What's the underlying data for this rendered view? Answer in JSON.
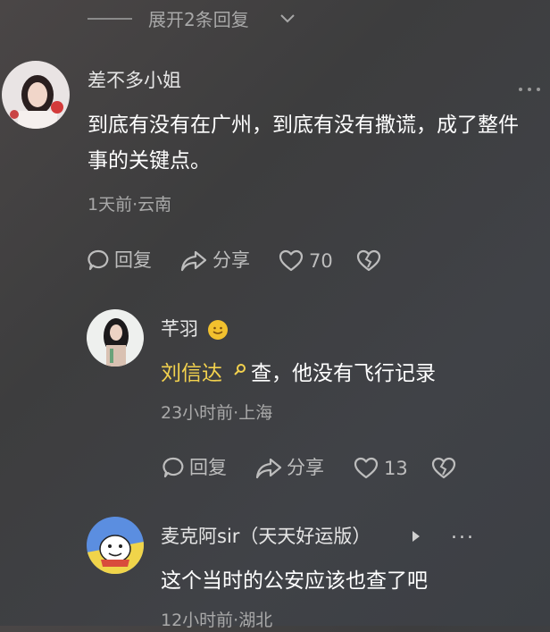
{
  "expand_replies": {
    "label": "展开2条回复"
  },
  "comments": [
    {
      "username": "差不多小姐",
      "content": "到底有没有在广州，到底有没有撒谎，成了整件事的关键点。",
      "meta": "1天前·云南",
      "reply_label": "回复",
      "share_label": "分享",
      "like_count": "70",
      "more_icon": "more-icon"
    },
    {
      "username": "芊羽",
      "mention": "刘信达",
      "content": "查，他没有飞行记录",
      "meta": "23小时前·上海",
      "reply_label": "回复",
      "share_label": "分享",
      "like_count": "13"
    },
    {
      "username": "麦克阿sir（天天好运版）",
      "content": "这个当时的公安应该也查了吧",
      "meta": "12小时前·湖北",
      "more_label": "..."
    }
  ],
  "colors": {
    "background": "#434244",
    "mention": "#f3d24e",
    "muted_text": "#a9a9a9"
  }
}
